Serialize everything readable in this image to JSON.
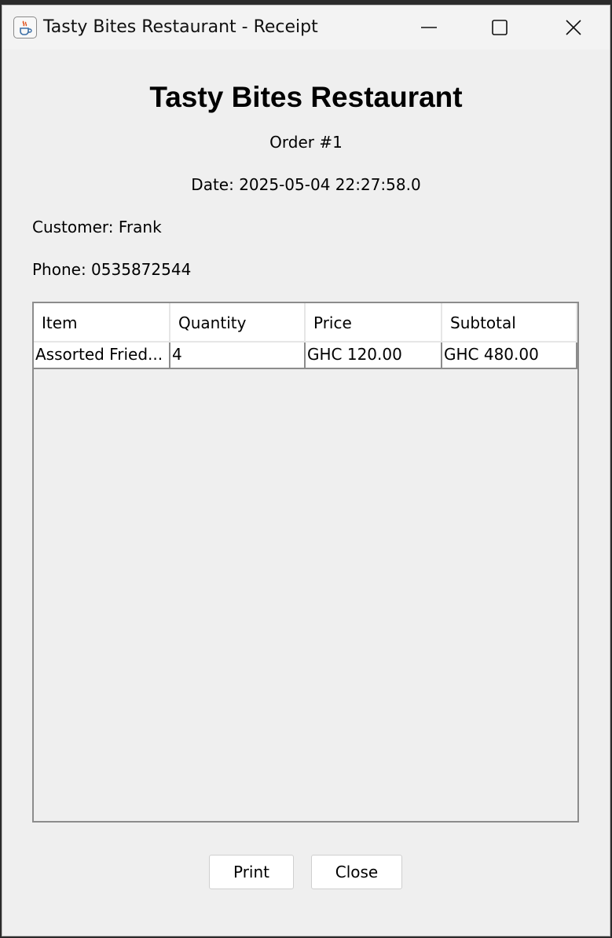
{
  "window": {
    "title": "Tasty Bites Restaurant - Receipt",
    "icons": {
      "app": "java-cup-icon",
      "minimize": "minimize-icon",
      "maximize": "maximize-icon",
      "close": "close-icon"
    }
  },
  "receipt": {
    "restaurant_name": "Tasty Bites Restaurant",
    "order": "Order #1",
    "date": "Date: 2025-05-04 22:27:58.0",
    "customer": "Customer: Frank",
    "phone": "Phone: 0535872544"
  },
  "table": {
    "columns": [
      "Item",
      "Quantity",
      "Price",
      "Subtotal"
    ],
    "rows": [
      [
        "Assorted Fried...",
        "4",
        "GHC 120.00",
        "GHC 480.00"
      ]
    ]
  },
  "buttons": {
    "print": "Print",
    "close": "Close"
  },
  "colors": {
    "window_bg": "#efefef",
    "table_border": "#8c8c8c"
  }
}
